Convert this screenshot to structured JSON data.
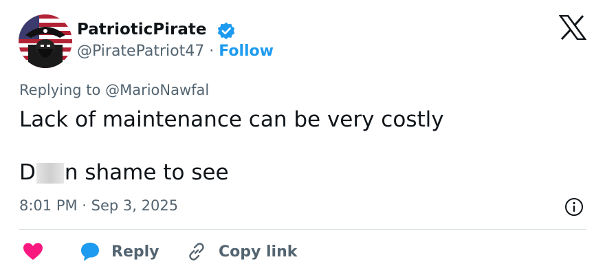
{
  "author": {
    "display_name": "PatrioticPirate",
    "handle": "@PiratePatriot47",
    "separator": " · ",
    "follow_label": "Follow"
  },
  "reply_context": {
    "prefix": "Replying to ",
    "target": "@MarioNawfal"
  },
  "tweet": {
    "line1": "Lack of maintenance can be very costly",
    "line2_start": "D",
    "line2_end": "n shame to see"
  },
  "timestamp": "8:01 PM · Sep 3, 2025",
  "actions": {
    "reply_label": "Reply",
    "copy_label": "Copy link"
  },
  "colors": {
    "accent": "#1d9bf0",
    "like": "#f91880",
    "muted": "#536471",
    "text": "#0f1419"
  },
  "icons": {
    "verified": "verified-badge-icon",
    "brand": "x-logo-icon",
    "info": "info-icon",
    "like": "heart-icon",
    "reply": "speech-bubble-icon",
    "copy": "link-icon"
  }
}
